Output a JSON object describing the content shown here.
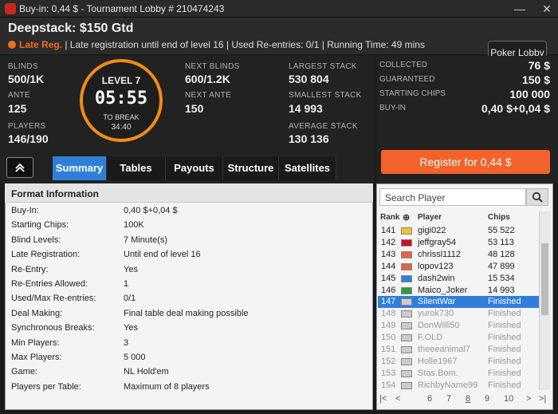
{
  "window": {
    "title": "Buy-in: 0,44 $ - Tournament Lobby # 210474243",
    "minimize": "—",
    "close": "✕"
  },
  "header": {
    "title": "Deepstack: $150 Gtd",
    "late_reg": "Late Reg.",
    "info": "| Late registration until end of level 16 | Used Re-entries: 0/1 | Running Time: 49 mins",
    "poker_lobby": "Poker Lobby"
  },
  "stats": {
    "blinds_label": "BLINDS",
    "blinds": "500/1K",
    "ante_label": "ANTE",
    "ante": "125",
    "players_label": "PLAYERS",
    "players": "146/190",
    "level": "LEVEL 7",
    "clock": "05:55",
    "to_break_label": "TO BREAK",
    "to_break": "34:40",
    "next_blinds_label": "NEXT BLINDS",
    "next_blinds": "600/1.2K",
    "next_ante_label": "NEXT ANTE",
    "next_ante": "150",
    "largest_label": "LARGEST STACK",
    "largest": "530 804",
    "smallest_label": "SMALLEST STACK",
    "smallest": "14 993",
    "average_label": "AVERAGE STACK",
    "average": "130 136"
  },
  "prize": {
    "collected_label": "COLLECTED",
    "collected": "76 $",
    "guaranteed_label": "GUARANTEED",
    "guaranteed": "150 $",
    "starting_label": "STARTING CHIPS",
    "starting": "100 000",
    "buyin_label": "BUY-IN",
    "buyin": "0,40 $+0,04 $",
    "register": "Register for  0,44 $"
  },
  "tabs": [
    "Summary",
    "Tables",
    "Payouts",
    "Structure",
    "Satellites"
  ],
  "format": {
    "heading": "Format Information",
    "rows": [
      {
        "k": "Buy-In:",
        "v": "0,40 $+0,04 $"
      },
      {
        "k": "Starting Chips:",
        "v": "100K"
      },
      {
        "k": "Blind Levels:",
        "v": "7 Minute(s)"
      },
      {
        "k": "Late Registration:",
        "v": "Until end of level 16"
      },
      {
        "k": "Re-Entry:",
        "v": "Yes"
      },
      {
        "k": "Re-Entries Allowed:",
        "v": "1"
      },
      {
        "k": "Used/Max Re-entries:",
        "v": "0/1"
      },
      {
        "k": "Deal Making:",
        "v": "Final table deal making possible"
      },
      {
        "k": "Synchronous Breaks:",
        "v": "Yes"
      },
      {
        "k": "Min Players:",
        "v": "3"
      },
      {
        "k": "Max Players:",
        "v": "5 000"
      },
      {
        "k": "Game:",
        "v": "NL Hold'em"
      },
      {
        "k": "Players per Table:",
        "v": "Maximum of 8 players"
      }
    ]
  },
  "players": {
    "search_placeholder": "Search Player",
    "headers": {
      "rank": "Rank",
      "player": "Player",
      "chips": "Chips"
    },
    "rows": [
      {
        "rank": "141",
        "name": "gigi022",
        "chips": "55 522",
        "flag": "#f2c12e"
      },
      {
        "rank": "142",
        "name": "jeffgray54",
        "chips": "53 113",
        "flag": "#c8102e"
      },
      {
        "rank": "143",
        "name": "chrissl1112",
        "chips": "48 128",
        "flag": "#d64"
      },
      {
        "rank": "144",
        "name": "lopov123",
        "chips": "47 899",
        "flag": "#d64"
      },
      {
        "rank": "145",
        "name": "dash2win",
        "chips": "15 534",
        "flag": "#2f7fd9"
      },
      {
        "rank": "146",
        "name": "Maico_Joker",
        "chips": "14 993",
        "flag": "#2a9d3a"
      },
      {
        "rank": "147",
        "name": "SilentWar",
        "chips": "Finished",
        "flag": "#ccc"
      },
      {
        "rank": "148",
        "name": "yurok730",
        "chips": "Finished",
        "flag": "#ccc"
      },
      {
        "rank": "149",
        "name": "DonWilli50",
        "chips": "Finished",
        "flag": "#ccc"
      },
      {
        "rank": "150",
        "name": "F.OLD",
        "chips": "Finished",
        "flag": "#ccc"
      },
      {
        "rank": "151",
        "name": "theeeanimal7",
        "chips": "Finished",
        "flag": "#ccc"
      },
      {
        "rank": "152",
        "name": "Holle1967",
        "chips": "Finished",
        "flag": "#ccc"
      },
      {
        "rank": "153",
        "name": "Stas.Bom.",
        "chips": "Finished",
        "flag": "#ccc"
      },
      {
        "rank": "154",
        "name": "RichbyName99",
        "chips": "Finished",
        "flag": "#ccc"
      }
    ],
    "pages": [
      "6",
      "7",
      "8",
      "9",
      "10"
    ]
  },
  "colors": {
    "accent": "#2f7fd9",
    "orange": "#f2622a"
  }
}
